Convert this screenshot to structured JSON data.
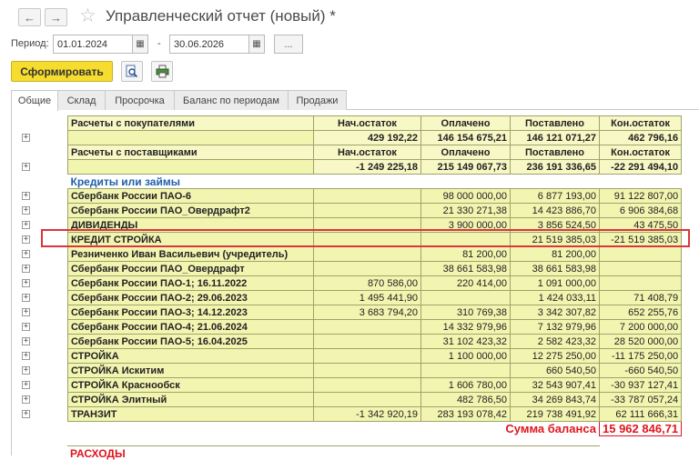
{
  "window": {
    "title": "Управленческий отчет (новый) *"
  },
  "period": {
    "label": "Период:",
    "from": "01.01.2024",
    "separator": "-",
    "to": "30.06.2026",
    "more_label": "..."
  },
  "toolbar": {
    "generate_label": "Сформировать"
  },
  "tabs": [
    {
      "label": "Общие",
      "active": true
    },
    {
      "label": "Склад"
    },
    {
      "label": "Просрочка"
    },
    {
      "label": "Баланс по периодам"
    },
    {
      "label": "Продажи"
    }
  ],
  "report": {
    "customers": {
      "label": "Расчеты с покупателями",
      "columns": [
        "Нач.остаток",
        "Оплачено",
        "Поставлено",
        "Кон.остаток"
      ],
      "totals": [
        "429 192,22",
        "146 154 675,21",
        "146 121 071,27",
        "462 796,16"
      ]
    },
    "suppliers": {
      "label": "Расчеты с поставщиками",
      "columns": [
        "Нач.остаток",
        "Оплачено",
        "Поставлено",
        "Кон.остаток"
      ],
      "totals": [
        "-1 249 225,18",
        "215 149 067,73",
        "236 191 336,65",
        "-22 291 494,10"
      ]
    },
    "loans_title": "Кредиты или займы",
    "rows": [
      {
        "name": "Сбербанк России ПАО-6",
        "c1": "",
        "c2": "98 000 000,00",
        "c3": "6 877 193,00",
        "c4": "91 122 807,00"
      },
      {
        "name": "Сбербанк России ПАО_Овердрафт2",
        "c1": "",
        "c2": "21 330 271,38",
        "c3": "14 423 886,70",
        "c4": "6 906 384,68"
      },
      {
        "name": "ДИВИДЕНДЫ",
        "c1": "",
        "c2": "3 900 000,00",
        "c3": "3 856 524,50",
        "c4": "43 475,50"
      },
      {
        "name": "КРЕДИТ СТРОЙКА",
        "c1": "",
        "c2": "",
        "c3": "21 519 385,03",
        "c4": "-21 519 385,03"
      },
      {
        "name": "Резниченко Иван Васильевич (учредитель)",
        "c1": "",
        "c2": "81 200,00",
        "c3": "81 200,00",
        "c4": ""
      },
      {
        "name": "Сбербанк России ПАО_Овердрафт",
        "c1": "",
        "c2": "38 661 583,98",
        "c3": "38 661 583,98",
        "c4": ""
      },
      {
        "name": "Сбербанк России ПАО-1; 16.11.2022",
        "c1": "870 586,00",
        "c2": "220 414,00",
        "c3": "1 091 000,00",
        "c4": ""
      },
      {
        "name": "Сбербанк России ПАО-2; 29.06.2023",
        "c1": "1 495 441,90",
        "c2": "",
        "c3": "1 424 033,11",
        "c4": "71 408,79"
      },
      {
        "name": "Сбербанк России ПАО-3; 14.12.2023",
        "c1": "3 683 794,20",
        "c2": "310 769,38",
        "c3": "3 342 307,82",
        "c4": "652 255,76"
      },
      {
        "name": "Сбербанк России ПАО-4; 21.06.2024",
        "c1": "",
        "c2": "14 332 979,96",
        "c3": "7 132 979,96",
        "c4": "7 200 000,00"
      },
      {
        "name": "Сбербанк России ПАО-5; 16.04.2025",
        "c1": "",
        "c2": "31 102 423,32",
        "c3": "2 582 423,32",
        "c4": "28 520 000,00"
      },
      {
        "name": "СТРОЙКА",
        "c1": "",
        "c2": "1 100 000,00",
        "c3": "12 275 250,00",
        "c4": "-11 175 250,00"
      },
      {
        "name": "СТРОЙКА Искитим",
        "c1": "",
        "c2": "",
        "c3": "660 540,50",
        "c4": "-660 540,50"
      },
      {
        "name": "СТРОЙКА Краснообск",
        "c1": "",
        "c2": "1 606 780,00",
        "c3": "32 543 907,41",
        "c4": "-30 937 127,41"
      },
      {
        "name": "СТРОЙКА Элитный",
        "c1": "",
        "c2": "482 786,50",
        "c3": "34 269 843,74",
        "c4": "-33 787 057,24"
      },
      {
        "name": "ТРАНЗИТ",
        "c1": "-1 342 920,19",
        "c2": "283 193 078,42",
        "c3": "219 738 491,92",
        "c4": "62 111 666,31"
      }
    ],
    "balance_label": "Сумма баланса",
    "balance_value": "15 962 846,71",
    "next_section": "РАСХОДЫ"
  }
}
